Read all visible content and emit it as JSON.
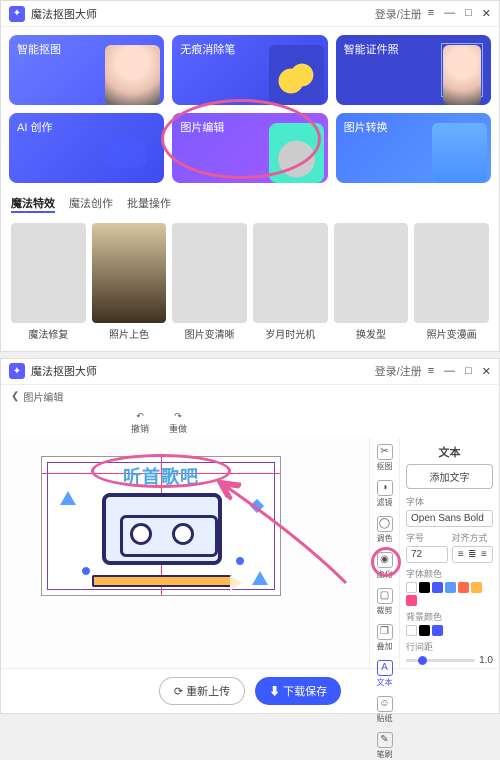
{
  "app": {
    "title": "魔法抠图大师",
    "login": "登录/注册"
  },
  "win_controls": {
    "menu": "≡",
    "min": "—",
    "max": "□",
    "close": "✕"
  },
  "cards": [
    {
      "label": "智能抠图"
    },
    {
      "label": "无痕消除笔"
    },
    {
      "label": "智能证件照"
    },
    {
      "label": "AI 创作"
    },
    {
      "label": "图片编辑"
    },
    {
      "label": "图片转换"
    }
  ],
  "tabs": [
    {
      "label": "魔法特效",
      "active": true
    },
    {
      "label": "魔法创作",
      "active": false
    },
    {
      "label": "批量操作",
      "active": false
    }
  ],
  "effects": [
    {
      "label": "魔法修复"
    },
    {
      "label": "照片上色"
    },
    {
      "label": "图片变清晰"
    },
    {
      "label": "岁月时光机"
    },
    {
      "label": "换发型"
    },
    {
      "label": "照片变漫画"
    }
  ],
  "editor": {
    "crumb_icon": "❮",
    "crumb": "图片编辑",
    "toolbar": {
      "undo": "撤销",
      "redo": "重做"
    },
    "canvas_text": "听首歌吧",
    "vtools": [
      {
        "label": "抠图",
        "icon": "✂"
      },
      {
        "label": "滤镜",
        "icon": "◑"
      },
      {
        "label": "调色",
        "icon": "◯"
      },
      {
        "label": "虚化",
        "icon": "◉"
      },
      {
        "label": "裁剪",
        "icon": "▢"
      },
      {
        "label": "叠加",
        "icon": "❐"
      },
      {
        "label": "文本",
        "icon": "A",
        "active": true
      },
      {
        "label": "贴纸",
        "icon": "☺"
      },
      {
        "label": "笔刷",
        "icon": "✎"
      }
    ],
    "props": {
      "heading": "文本",
      "add_text": "添加文字",
      "font_label": "字体",
      "font_value": "Open Sans Bold",
      "size_label": "字号",
      "size_value": "72",
      "align_label": "对齐方式",
      "color_label": "字体颜色",
      "bg_label": "背景颜色",
      "spacing_label": "行间距",
      "spacing_value": "1.0",
      "font_colors": [
        "#ffffff",
        "#000000",
        "#4a56ff",
        "#5a9bff",
        "#ff6b4a",
        "#ffb84a",
        "#ff4a8a",
        "#4ad6b0"
      ],
      "bg_colors": [
        "#ffffff",
        "#000000",
        "#4a56ff"
      ]
    },
    "actions": {
      "reupload": "重新上传",
      "save": "下载保存",
      "reupload_icon": "⟳",
      "save_icon": "⬇"
    }
  }
}
